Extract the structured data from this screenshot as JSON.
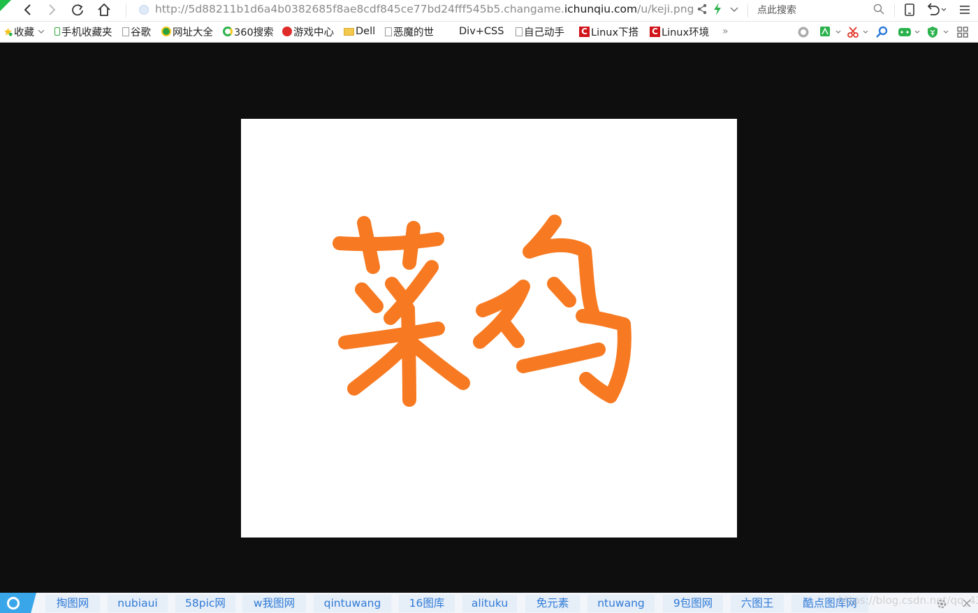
{
  "toolbar": {
    "url_prefix": "http://5d88211b1d6a4b0382685f8ae8cdf845ce77bd24fff545b5.changame.",
    "url_host": "ichunqiu.com",
    "url_suffix": "/u/keji.png",
    "search_placeholder": "点此搜索"
  },
  "bookmarks": {
    "items": [
      {
        "label": "收藏",
        "icon": "star-icon"
      },
      {
        "label": "手机收藏夹",
        "icon": "phone-icon"
      },
      {
        "label": "谷歌",
        "icon": "page-icon"
      },
      {
        "label": "网址大全",
        "icon": "site-icon"
      },
      {
        "label": "360搜索",
        "icon": "search-360-icon"
      },
      {
        "label": "游戏中心",
        "icon": "game-icon"
      },
      {
        "label": "Dell",
        "icon": "folder-icon"
      },
      {
        "label": "恶魔的世",
        "icon": "page-icon"
      },
      {
        "label": "Div+CSS",
        "icon": "grid-icon"
      },
      {
        "label": "自己动手",
        "icon": "page-icon"
      },
      {
        "label": "Linux下搭",
        "icon": "csdn-icon"
      },
      {
        "label": "Linux环境",
        "icon": "csdn-icon"
      }
    ],
    "more": "»",
    "csdn_letter": "C"
  },
  "image": {
    "text": "菜鸡",
    "stroke_color": "#f77a22"
  },
  "bottombar": {
    "links": [
      "掏图网",
      "nubiaui",
      "58pic网",
      "w我图网",
      "qintuwang",
      "16图库",
      "alituku",
      "免元素",
      "ntuwang",
      "9包图网",
      "六图王",
      "酷点图库网"
    ],
    "watermark": "https://blog.csdn.net/qq_43463158"
  },
  "colors": {
    "accent": "#3aa6ea",
    "link": "#2f7ad6",
    "viewer_bg": "#0e0e0e"
  }
}
